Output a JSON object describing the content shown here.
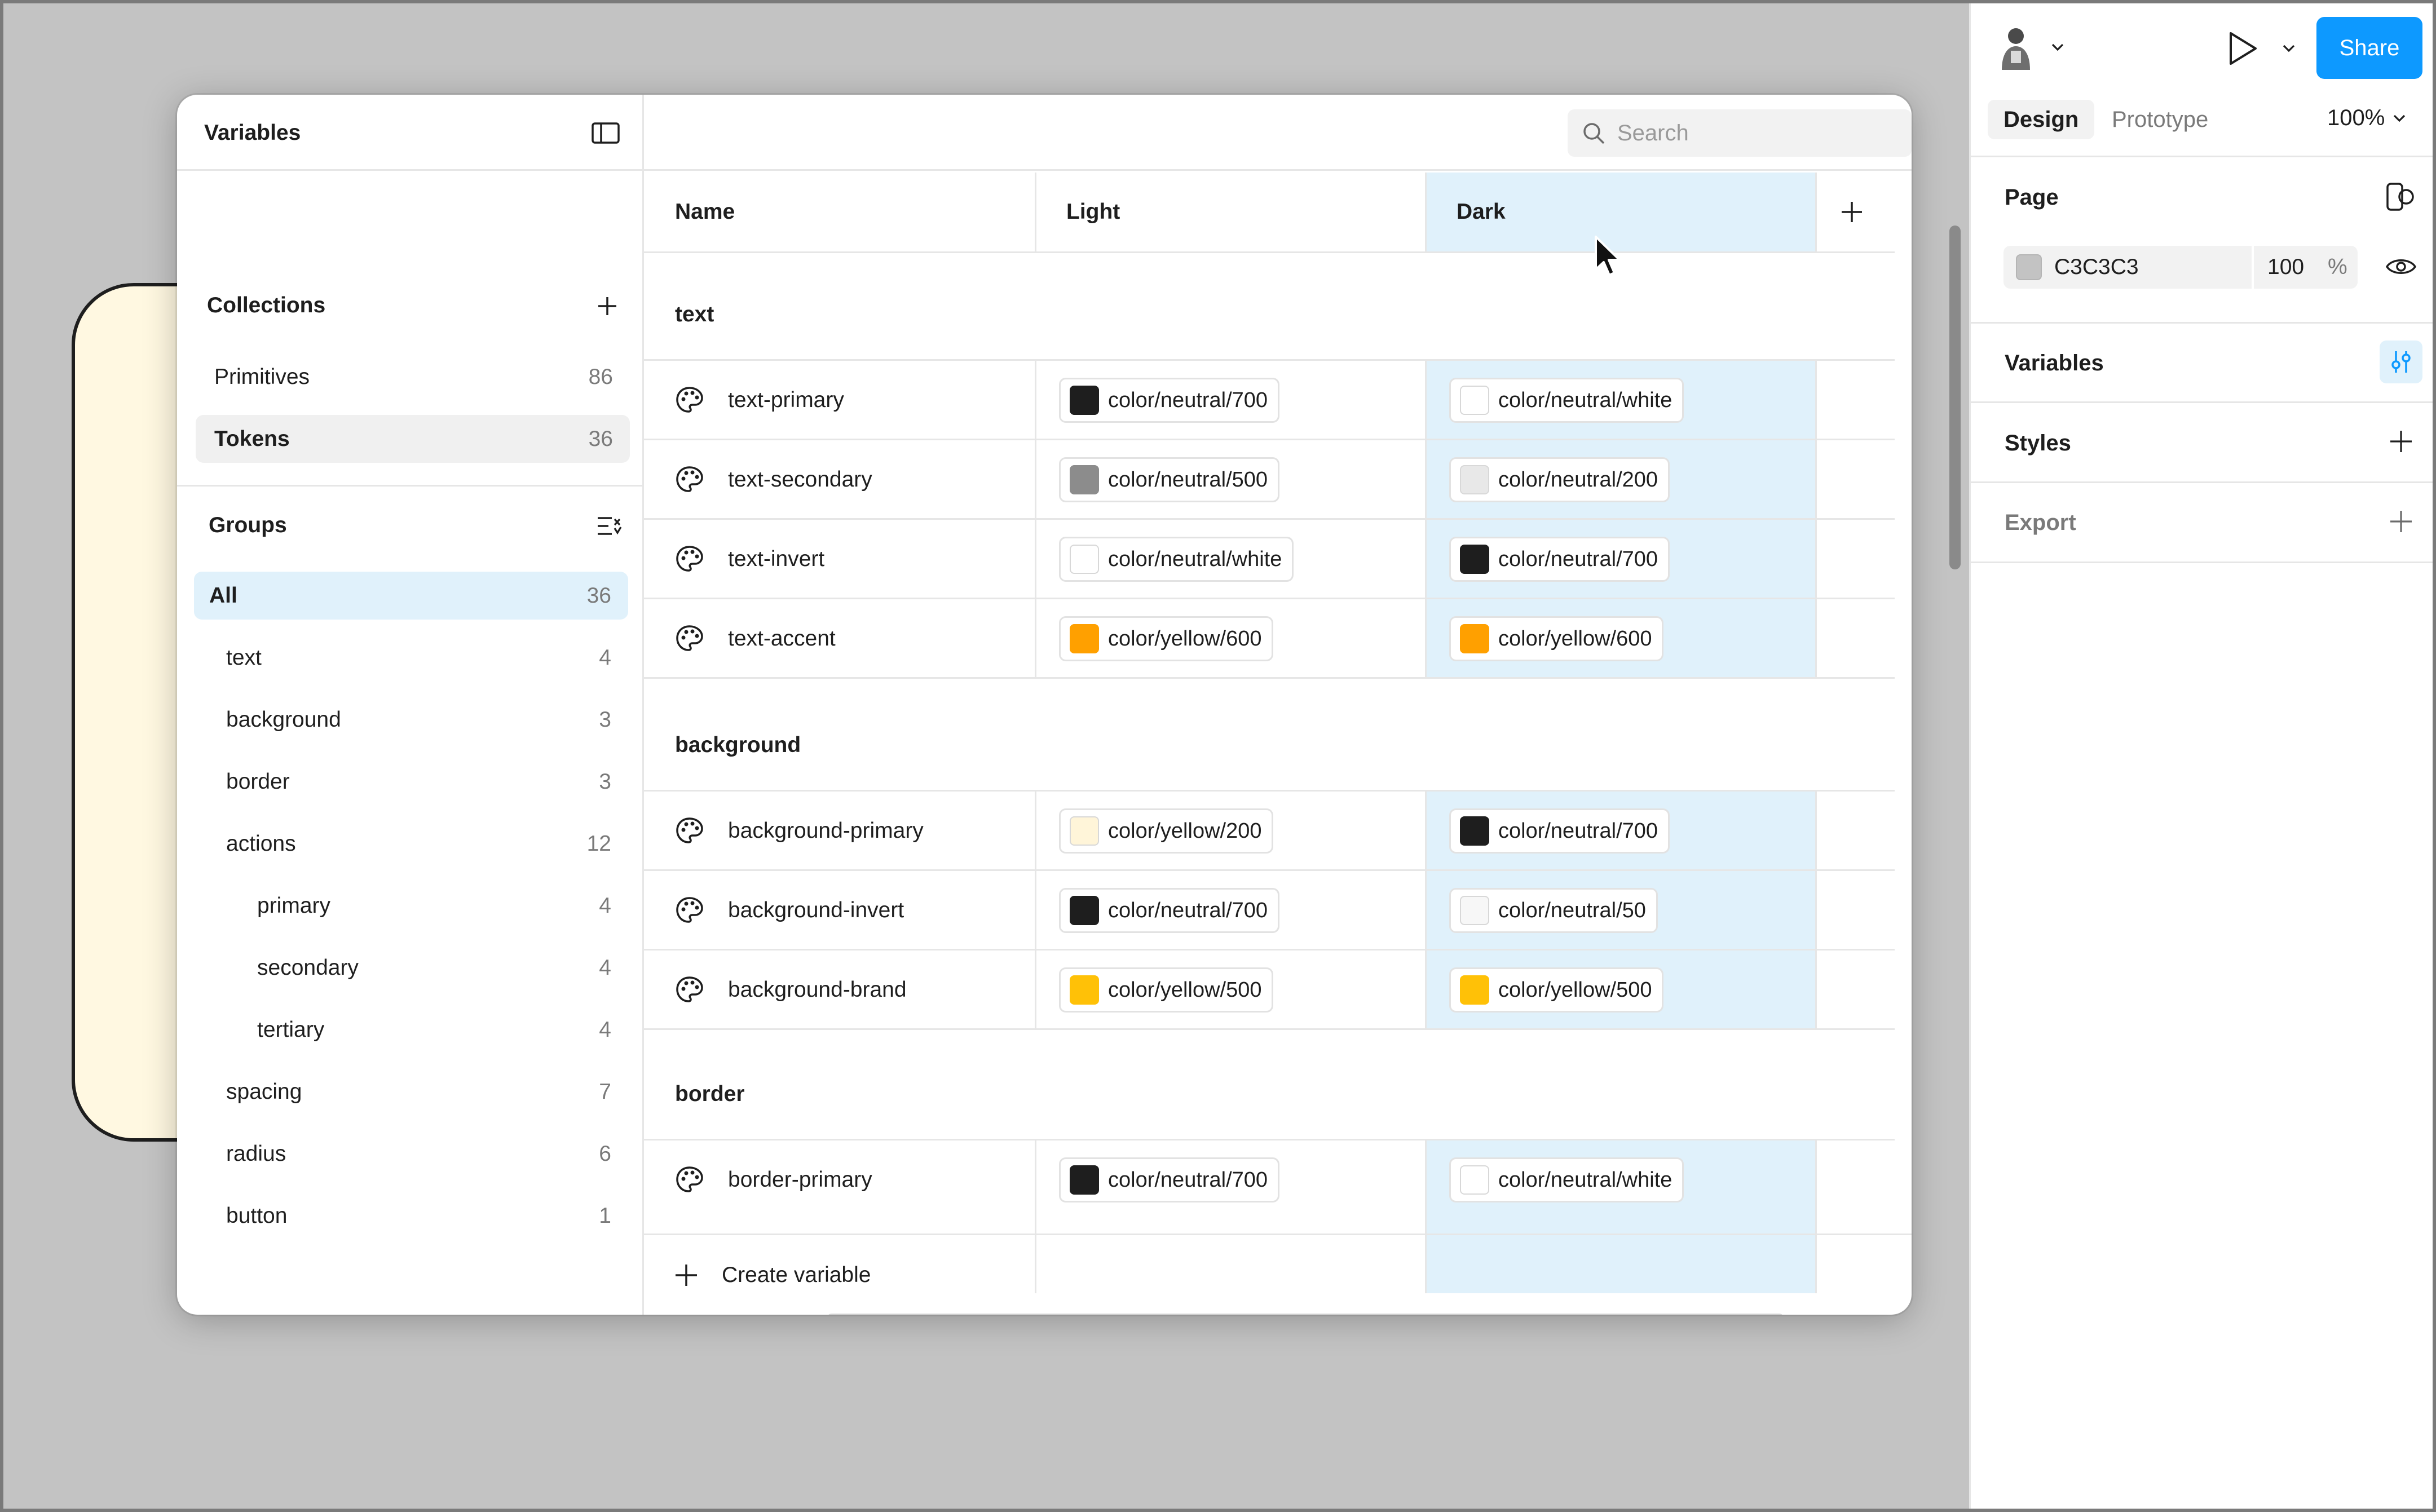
{
  "canvas": {
    "background_color": "#C3C3C3"
  },
  "modal": {
    "title": "Variables",
    "collections_title": "Collections",
    "collections": [
      {
        "label": "Primitives",
        "count": "86"
      },
      {
        "label": "Tokens",
        "count": "36"
      }
    ],
    "groups_title": "Groups",
    "groups": [
      {
        "label": "All",
        "count": "36"
      },
      {
        "label": "text",
        "count": "4"
      },
      {
        "label": "background",
        "count": "3"
      },
      {
        "label": "border",
        "count": "3"
      },
      {
        "label": "actions",
        "count": "12"
      },
      {
        "label": "primary",
        "count": "4"
      },
      {
        "label": "secondary",
        "count": "4"
      },
      {
        "label": "tertiary",
        "count": "4"
      },
      {
        "label": "spacing",
        "count": "7"
      },
      {
        "label": "radius",
        "count": "6"
      },
      {
        "label": "button",
        "count": "1"
      }
    ],
    "search_placeholder": "Search",
    "columns": [
      "Name",
      "Light",
      "Dark"
    ],
    "variable_groups": [
      {
        "name": "text",
        "rows": [
          {
            "name": "text-primary",
            "light": {
              "label": "color/neutral/700",
              "color": "#1e1e1e"
            },
            "dark": {
              "label": "color/neutral/white",
              "color": "#ffffff"
            }
          },
          {
            "name": "text-secondary",
            "light": {
              "label": "color/neutral/500",
              "color": "#8c8c8c"
            },
            "dark": {
              "label": "color/neutral/200",
              "color": "#e8e8e8"
            }
          },
          {
            "name": "text-invert",
            "light": {
              "label": "color/neutral/white",
              "color": "#ffffff"
            },
            "dark": {
              "label": "color/neutral/700",
              "color": "#1e1e1e"
            }
          },
          {
            "name": "text-accent",
            "light": {
              "label": "color/yellow/600",
              "color": "#ffa000"
            },
            "dark": {
              "label": "color/yellow/600",
              "color": "#ffa000"
            }
          }
        ]
      },
      {
        "name": "background",
        "rows": [
          {
            "name": "background-primary",
            "light": {
              "label": "color/yellow/200",
              "color": "#fff5d9"
            },
            "dark": {
              "label": "color/neutral/700",
              "color": "#1e1e1e"
            }
          },
          {
            "name": "background-invert",
            "light": {
              "label": "color/neutral/700",
              "color": "#1e1e1e"
            },
            "dark": {
              "label": "color/neutral/50",
              "color": "#f7f7f7"
            }
          },
          {
            "name": "background-brand",
            "light": {
              "label": "color/yellow/500",
              "color": "#ffc107"
            },
            "dark": {
              "label": "color/yellow/500",
              "color": "#ffc107"
            }
          }
        ]
      },
      {
        "name": "border",
        "rows": [
          {
            "name": "border-primary",
            "light": {
              "label": "color/neutral/700",
              "color": "#1e1e1e"
            },
            "dark": {
              "label": "color/neutral/white",
              "color": "#ffffff"
            }
          }
        ]
      }
    ],
    "create_label": "Create variable"
  },
  "design_panel": {
    "share_label": "Share",
    "tabs": [
      "Design",
      "Prototype"
    ],
    "zoom": "100%",
    "page_label": "Page",
    "page_color": "C3C3C3",
    "page_opacity": "100",
    "percent": "%",
    "variables_label": "Variables",
    "styles_label": "Styles",
    "export_label": "Export"
  },
  "colors": {
    "accent": "#0D99FF",
    "dark_column": "#E0F1FB"
  }
}
